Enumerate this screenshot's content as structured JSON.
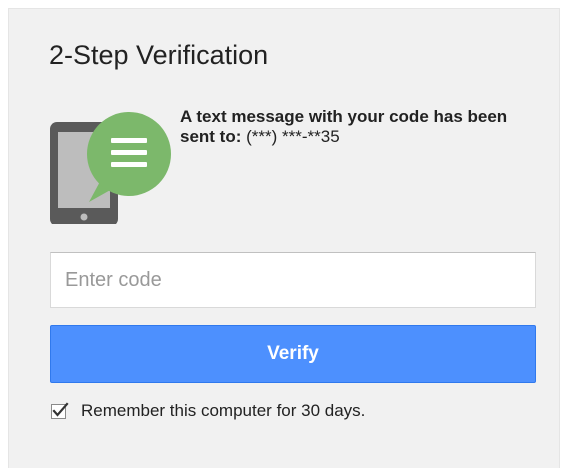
{
  "title": "2-Step Verification",
  "message": {
    "bold_text": "A text message with your code has been sent to:",
    "phone": "(***) ***-**35"
  },
  "code_input": {
    "placeholder": "Enter code",
    "value": ""
  },
  "verify_button": {
    "label": "Verify"
  },
  "remember": {
    "checked": true,
    "label": "Remember this computer for 30 days."
  },
  "icons": {
    "illustration": "phone-with-sms-bubble-icon",
    "checkbox": "checkmark-icon"
  },
  "colors": {
    "primary_button": "#4d90fe",
    "bubble_green": "#7cb86b",
    "phone_body": "#5a5a5a",
    "card_background": "#f1f1f1"
  }
}
